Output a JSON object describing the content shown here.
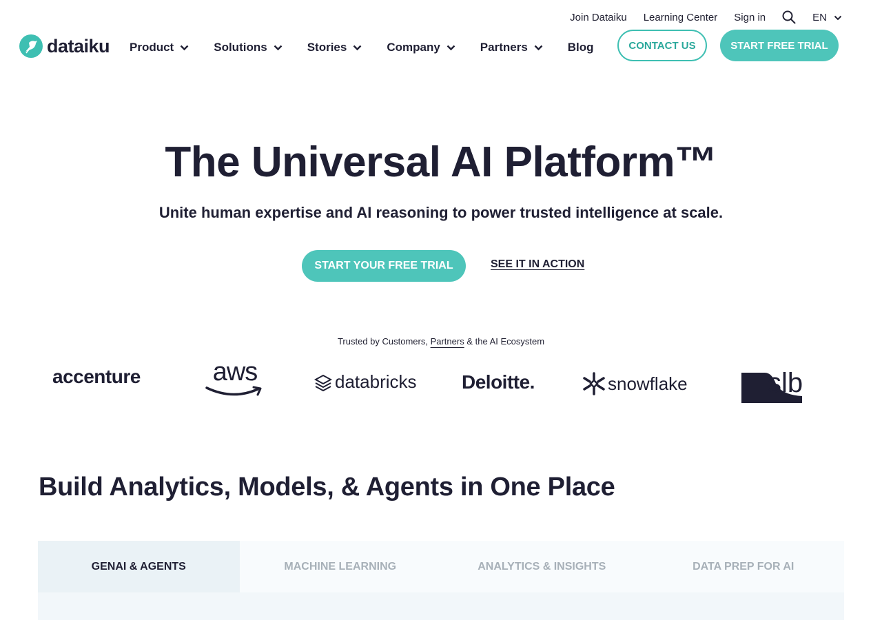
{
  "utility_nav": {
    "join": "Join Dataiku",
    "learning": "Learning Center",
    "signin": "Sign in",
    "language": "EN"
  },
  "logo": {
    "text": "dataiku"
  },
  "main_nav": [
    {
      "label": "Product"
    },
    {
      "label": "Solutions"
    },
    {
      "label": "Stories"
    },
    {
      "label": "Company"
    },
    {
      "label": "Partners"
    },
    {
      "label": "Blog"
    }
  ],
  "header_buttons": {
    "contact": "CONTACT US",
    "trial": "START FREE TRIAL"
  },
  "hero": {
    "title": "The Universal AI Platform™",
    "subtitle": "Unite human expertise and AI reasoning to power trusted intelligence at scale.",
    "cta_primary": "START YOUR FREE TRIAL",
    "cta_secondary": "SEE IT IN ACTION"
  },
  "trusted": {
    "prefix": "Trusted by Customers, ",
    "partners": "Partners",
    "suffix": " & the AI Ecosystem"
  },
  "partner_logos": {
    "accenture": "accenture",
    "aws": "aws",
    "databricks": "databricks",
    "deloitte": "Deloitte.",
    "snowflake": "snowflake",
    "slb": "slb"
  },
  "section": {
    "title": "Build Analytics, Models, & Agents in One Place"
  },
  "tabs": [
    {
      "label": "GENAI & AGENTS",
      "active": true
    },
    {
      "label": "MACHINE LEARNING",
      "active": false
    },
    {
      "label": "ANALYTICS & INSIGHTS",
      "active": false
    },
    {
      "label": "DATA PREP FOR AI",
      "active": false
    }
  ],
  "colors": {
    "brand_teal": "#3ebfb2",
    "button_teal": "#4ec5ba",
    "text_dark": "#1f1f33",
    "tab_inactive": "#a7b0b8"
  }
}
